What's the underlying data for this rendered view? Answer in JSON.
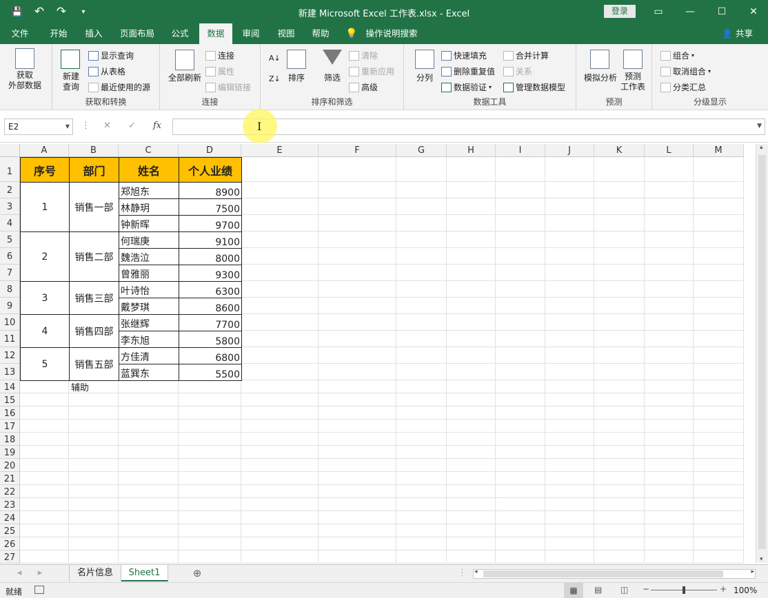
{
  "window": {
    "title": "新建 Microsoft Excel 工作表.xlsx  -  Excel",
    "login_label": "登录",
    "qat": {
      "save": "💾",
      "undo": "↶",
      "redo": "↷",
      "customize": "▾"
    },
    "controls": {
      "ribbon_display": "▭",
      "minimize": "—",
      "maximize": "☐",
      "close": "✕"
    }
  },
  "tabs": [
    "文件",
    "开始",
    "插入",
    "页面布局",
    "公式",
    "数据",
    "审阅",
    "视图",
    "帮助",
    "操作说明搜索"
  ],
  "active_tab": "数据",
  "share_label": "共享",
  "ribbon": {
    "get_transform": {
      "label": "获取和转换",
      "get_external": "获取\n外部数据",
      "new_query": "新建\n查询",
      "show_queries": "显示查询",
      "from_table": "从表格",
      "recent_sources": "最近使用的源"
    },
    "connections": {
      "label": "连接",
      "refresh_all": "全部刷新",
      "connections": "连接",
      "properties": "属性",
      "edit_links": "编辑链接"
    },
    "sort_filter": {
      "label": "排序和筛选",
      "sort": "排序",
      "filter": "筛选",
      "clear": "清除",
      "reapply": "重新应用",
      "advanced": "高级"
    },
    "data_tools": {
      "label": "数据工具",
      "text_to_columns": "分列",
      "flash_fill": "快速填充",
      "remove_duplicates": "删除重复值",
      "data_validation": "数据验证",
      "consolidate": "合并计算",
      "relationships": "关系",
      "manage_model": "管理数据模型"
    },
    "forecast": {
      "label": "预测",
      "what_if": "模拟分析",
      "forecast_sheet": "预测\n工作表"
    },
    "outline": {
      "label": "分级显示",
      "group": "组合",
      "ungroup": "取消组合",
      "subtotal": "分类汇总"
    }
  },
  "formula_bar": {
    "name_box": "E2",
    "fx": "fx",
    "value": ""
  },
  "columns": [
    "A",
    "B",
    "C",
    "D",
    "E",
    "F",
    "G",
    "H",
    "I",
    "J",
    "K",
    "L",
    "M"
  ],
  "rows": [
    "1",
    "2",
    "3",
    "4",
    "5",
    "6",
    "7",
    "8",
    "9",
    "10",
    "11",
    "12",
    "13",
    "14",
    "15",
    "16",
    "17",
    "18",
    "19",
    "20",
    "21",
    "22",
    "23",
    "24",
    "25",
    "26",
    "27"
  ],
  "table": {
    "headers": [
      "序号",
      "部门",
      "姓名",
      "个人业绩"
    ],
    "groups": [
      {
        "no": "1",
        "dept": "销售一部",
        "people": [
          [
            "郑旭东",
            "8900"
          ],
          [
            "林静玥",
            "7500"
          ],
          [
            "钟新晖",
            "9700"
          ]
        ]
      },
      {
        "no": "2",
        "dept": "销售二部",
        "people": [
          [
            "何瑞庚",
            "9100"
          ],
          [
            "魏浩泣",
            "8000"
          ],
          [
            "曾雅丽",
            "9300"
          ]
        ]
      },
      {
        "no": "3",
        "dept": "销售三部",
        "people": [
          [
            "叶诗怡",
            "6300"
          ],
          [
            "戴梦琪",
            "8600"
          ]
        ]
      },
      {
        "no": "4",
        "dept": "销售四部",
        "people": [
          [
            "张继辉",
            "7700"
          ],
          [
            "李东旭",
            "5800"
          ]
        ]
      },
      {
        "no": "5",
        "dept": "销售五部",
        "people": [
          [
            "方佳清",
            "6800"
          ],
          [
            "蓝巽东",
            "5500"
          ]
        ]
      }
    ],
    "helper_label": "辅助"
  },
  "sheets": [
    "名片信息",
    "Sheet1"
  ],
  "active_sheet": "Sheet1",
  "status": {
    "ready": "就绪",
    "zoom": "100%"
  }
}
